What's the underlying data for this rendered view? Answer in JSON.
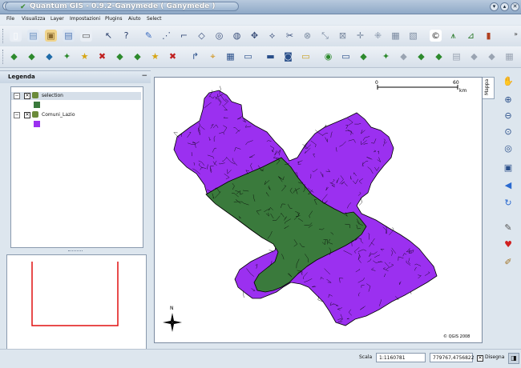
{
  "window": {
    "title": "Quantum GIS - 0.9.2-Ganymede ( Ganymede )",
    "menu_glyph": "▾",
    "minimize_glyph": "▾",
    "maximize_glyph": "▴",
    "close_glyph": "✕"
  },
  "menubar": [
    {
      "label": "File"
    },
    {
      "label": "Visualizza"
    },
    {
      "label": "Layer"
    },
    {
      "label": "Impostazioni"
    },
    {
      "label": "Plugins"
    },
    {
      "label": "Aiuto"
    },
    {
      "label": "Select"
    }
  ],
  "toolbar1": [
    {
      "name": "new-project-icon",
      "glyph": "▯",
      "color": "#ffffff",
      "bg": "#e9eef5"
    },
    {
      "name": "open-project-icon",
      "glyph": "▤",
      "color": "#6a8fc0",
      "bg": "#dfe8f3"
    },
    {
      "name": "save-project-icon",
      "glyph": "▣",
      "color": "#8a6a30",
      "bg": "#f0d48c"
    },
    {
      "name": "save-as-icon",
      "glyph": "▤",
      "color": "#4f78b5",
      "bg": "#dfe8f3"
    },
    {
      "name": "print-icon",
      "glyph": "▭",
      "color": "#555",
      "bg": "#e9eef5"
    },
    {
      "name": "pointer-icon",
      "glyph": "↖",
      "color": "#2a3f6b",
      "bg": "transparent"
    },
    {
      "name": "whats-this-icon",
      "glyph": "?",
      "color": "#2a3f6b",
      "bg": "transparent"
    },
    {
      "name": "capture-point-icon",
      "glyph": "✎",
      "color": "#3a6bc0",
      "bg": "transparent"
    },
    {
      "name": "capture-line-icon",
      "glyph": "⋰",
      "color": "#3a4f7a",
      "bg": "transparent"
    },
    {
      "name": "capture-polygon-icon",
      "glyph": "⌐",
      "color": "#3a4f7a",
      "bg": "transparent"
    },
    {
      "name": "move-feature-icon",
      "glyph": "◇",
      "color": "#3a4f7a",
      "bg": "transparent"
    },
    {
      "name": "add-ring-icon",
      "glyph": "◎",
      "color": "#3a4f7a",
      "bg": "transparent"
    },
    {
      "name": "add-island-icon",
      "glyph": "◍",
      "color": "#3a4f7a",
      "bg": "transparent"
    },
    {
      "name": "move-vertex-icon",
      "glyph": "✥",
      "color": "#3a4f7a",
      "bg": "transparent"
    },
    {
      "name": "split-feature-icon",
      "glyph": "⟡",
      "color": "#3a4f7a",
      "bg": "transparent"
    },
    {
      "name": "cut-feature-icon",
      "glyph": "✂",
      "color": "#3a4f7a",
      "bg": "transparent"
    },
    {
      "name": "delete-vertex-icon",
      "glyph": "⊗",
      "color": "#7a8aa0",
      "bg": "transparent"
    },
    {
      "name": "add-vertex-icon",
      "glyph": "⤡",
      "color": "#7a8aa0",
      "bg": "transparent"
    },
    {
      "name": "delete-feature-icon",
      "glyph": "⊠",
      "color": "#7a8aa0",
      "bg": "transparent"
    },
    {
      "name": "pan-arrows-icon",
      "glyph": "✛",
      "color": "#7a8aa0",
      "bg": "transparent"
    },
    {
      "name": "copy-feature-icon",
      "glyph": "⁜",
      "color": "#7a8aa0",
      "bg": "transparent"
    },
    {
      "name": "paste-feature-icon",
      "glyph": "▦",
      "color": "#7a8aa0",
      "bg": "transparent"
    },
    {
      "name": "scissors-icon",
      "glyph": "▧",
      "color": "#7a8aa0",
      "bg": "transparent"
    },
    {
      "name": "copyright-icon",
      "glyph": "©",
      "color": "#222",
      "bg": "#fff"
    },
    {
      "name": "north-arrow-tool-icon",
      "glyph": "⩚",
      "color": "#2a7a2a",
      "bg": "transparent"
    },
    {
      "name": "scale-bar-tool-icon",
      "glyph": "⊿",
      "color": "#2a7a2a",
      "bg": "transparent"
    },
    {
      "name": "plugin-tool-icon",
      "glyph": "▮",
      "color": "#b04020",
      "bg": "transparent"
    }
  ],
  "toolbar2": [
    {
      "name": "add-vector-layer-icon",
      "glyph": "◆",
      "color": "#2d8a2d",
      "bg": "transparent"
    },
    {
      "name": "add-raster-layer-icon",
      "glyph": "◆",
      "color": "#2d8a2d",
      "bg": "transparent"
    },
    {
      "name": "add-postgis-layer-icon",
      "glyph": "◆",
      "color": "#1f6ba8",
      "bg": "transparent"
    },
    {
      "name": "add-wms-layer-icon",
      "glyph": "✦",
      "color": "#2d8a2d",
      "bg": "transparent"
    },
    {
      "name": "new-vector-layer-icon",
      "glyph": "★",
      "color": "#d6a514",
      "bg": "transparent"
    },
    {
      "name": "remove-layer-icon",
      "glyph": "✖",
      "color": "#c02020",
      "bg": "transparent"
    },
    {
      "name": "show-all-layers-icon",
      "glyph": "◆",
      "color": "#2d8a2d",
      "bg": "transparent"
    },
    {
      "name": "hide-all-layers-icon",
      "glyph": "◆",
      "color": "#2d8a2d",
      "bg": "transparent"
    },
    {
      "name": "add-to-overview-icon",
      "glyph": "★",
      "color": "#d6a514",
      "bg": "transparent"
    },
    {
      "name": "remove-from-overview-icon",
      "glyph": "✖",
      "color": "#c02020",
      "bg": "transparent"
    },
    {
      "name": "identify-icon",
      "glyph": "↱",
      "color": "#2a4f8a",
      "bg": "transparent"
    },
    {
      "name": "select-features-icon",
      "glyph": "⌖",
      "color": "#d09010",
      "bg": "transparent"
    },
    {
      "name": "open-table-icon",
      "glyph": "▦",
      "color": "#2a4f8a",
      "bg": "transparent"
    },
    {
      "name": "measure-line-icon",
      "glyph": "▭",
      "color": "#2a4f8a",
      "bg": "transparent"
    },
    {
      "name": "measure-area-icon",
      "glyph": "▬",
      "color": "#2a4f8a",
      "bg": "transparent"
    },
    {
      "name": "zoom-in-box-icon",
      "glyph": "◙",
      "color": "#2a4f8a",
      "bg": "transparent"
    },
    {
      "name": "map-tips-icon",
      "glyph": "▭",
      "color": "#c8a020",
      "bg": "transparent"
    },
    {
      "name": "bookmark-icon",
      "glyph": "◉",
      "color": "#2d8a2d",
      "bg": "transparent"
    },
    {
      "name": "new-bookmark-icon",
      "glyph": "▭",
      "color": "#2a4f8a",
      "bg": "transparent"
    },
    {
      "name": "georef-icon",
      "glyph": "◆",
      "color": "#2d8a2d",
      "bg": "transparent"
    },
    {
      "name": "grid-maker-icon",
      "glyph": "✦",
      "color": "#2d8a2d",
      "bg": "transparent"
    },
    {
      "name": "gps-icon",
      "glyph": "◆",
      "color": "#9aa4b2",
      "bg": "transparent"
    },
    {
      "name": "delimited-text-icon",
      "glyph": "◆",
      "color": "#2d8a2d",
      "bg": "transparent"
    },
    {
      "name": "spit-icon",
      "glyph": "◆",
      "color": "#2d8a2d",
      "bg": "transparent"
    },
    {
      "name": "graticule-icon",
      "glyph": "▤",
      "color": "#9aa4b2",
      "bg": "transparent"
    },
    {
      "name": "wfs-icon",
      "glyph": "◆",
      "color": "#9aa4b2",
      "bg": "transparent"
    },
    {
      "name": "grass-icon",
      "glyph": "◆",
      "color": "#9aa4b2",
      "bg": "transparent"
    },
    {
      "name": "grass-tools-icon",
      "glyph": "▦",
      "color": "#9aa4b2",
      "bg": "transparent"
    },
    {
      "name": "python-icon",
      "glyph": "◆",
      "color": "#9aa4b2",
      "bg": "transparent"
    }
  ],
  "toolbar_more": "»",
  "legend": {
    "title": "Legenda",
    "collapse_glyph": "−",
    "layers": [
      {
        "name": "selection",
        "color": "#3a7a3c",
        "checked": true
      },
      {
        "name": "Comuni_Lazio",
        "color": "#9b30f0",
        "checked": true
      }
    ]
  },
  "map": {
    "tab_label": "Mappa",
    "scalebar_start": "0",
    "scalebar_end": "60",
    "scalebar_unit": "km",
    "north_label": "N",
    "copyright": "© QGIS 2008",
    "fill_selected": "#3a7a3c",
    "fill_other": "#9b30f0"
  },
  "right_toolbar": [
    {
      "name": "pan-hand-icon",
      "glyph": "✋",
      "color": "#2a4f8a"
    },
    {
      "name": "zoom-in-icon",
      "glyph": "⊕",
      "color": "#2a4f8a"
    },
    {
      "name": "zoom-out-icon",
      "glyph": "⊖",
      "color": "#2a4f8a"
    },
    {
      "name": "zoom-full-icon",
      "glyph": "⊙",
      "color": "#2a4f8a"
    },
    {
      "name": "zoom-selection-icon",
      "glyph": "◎",
      "color": "#2a4f8a"
    },
    {
      "name": "zoom-layer-icon",
      "glyph": "▣",
      "color": "#2a4f8a"
    },
    {
      "name": "zoom-last-icon",
      "glyph": "◀",
      "color": "#2a6ad0"
    },
    {
      "name": "refresh-icon",
      "glyph": "↻",
      "color": "#2a6ad0"
    },
    {
      "name": "settings-wrench-icon",
      "glyph": "✎",
      "color": "#555"
    },
    {
      "name": "favourite-heart-icon",
      "glyph": "♥",
      "color": "#d02020"
    },
    {
      "name": "edit-pencil-icon",
      "glyph": "✐",
      "color": "#a07020"
    }
  ],
  "status": {
    "scale_label": "Scala",
    "scale_value": "1:1160781",
    "coordinates": "779767,4756822",
    "render_label": "Disegna",
    "render_checked": true
  }
}
